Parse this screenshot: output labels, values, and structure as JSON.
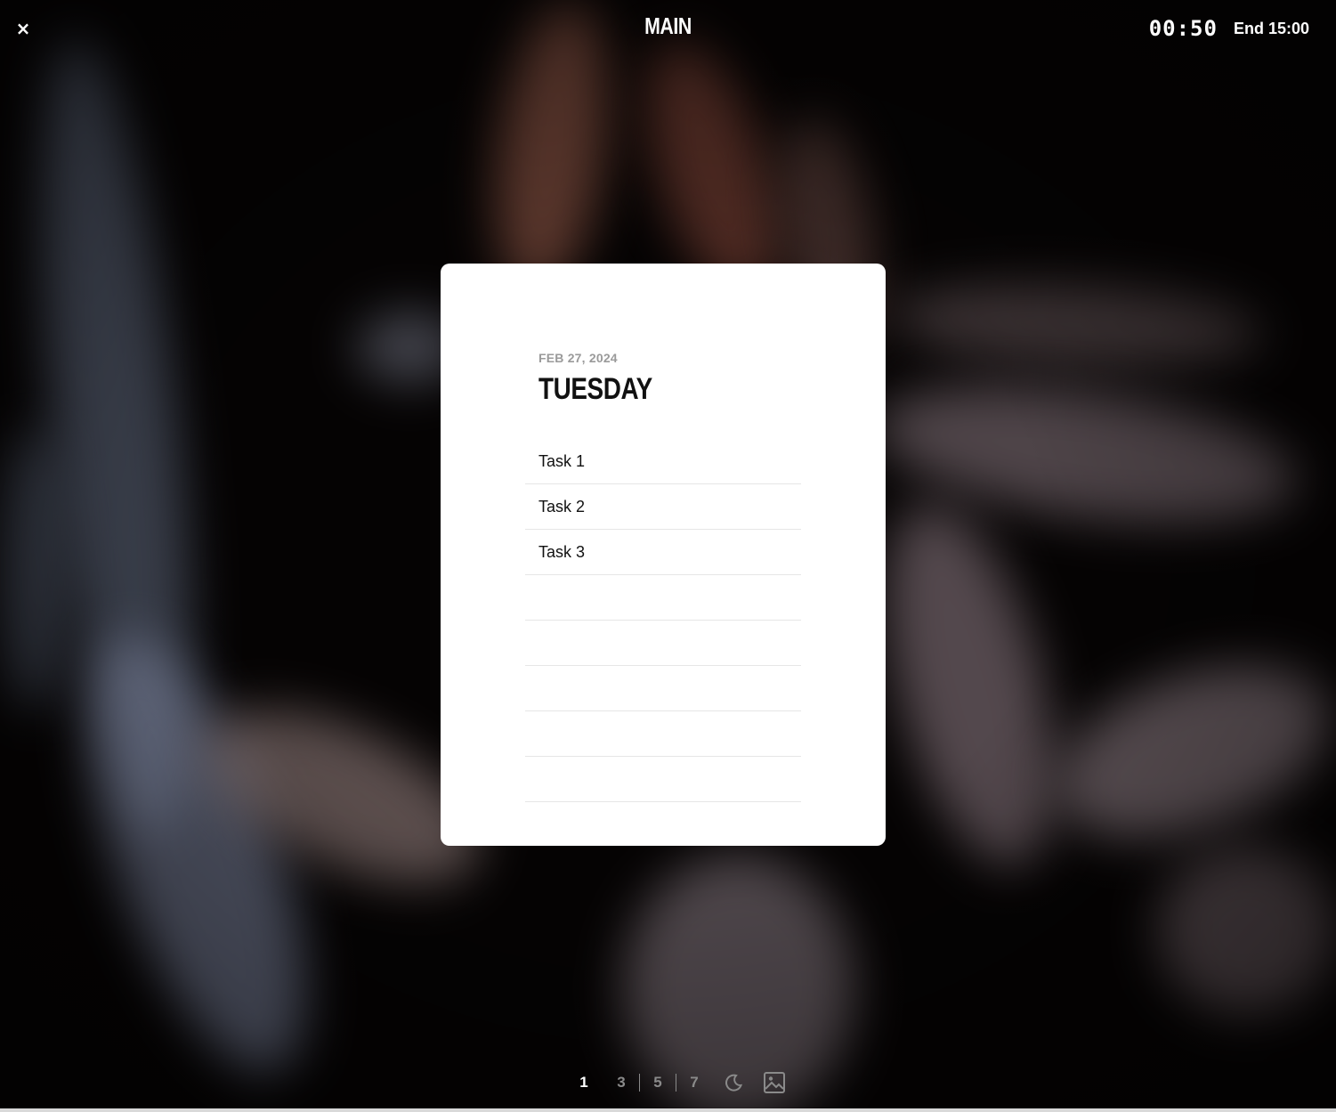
{
  "header": {
    "close_label": "×",
    "title": "MAIN",
    "timer": "00:50",
    "end_time": "End 15:00"
  },
  "card": {
    "date": "FEB 27, 2024",
    "day": "TUESDAY",
    "tasks": [
      "Task 1",
      "Task 2",
      "Task 3",
      "",
      "",
      "",
      "",
      ""
    ]
  },
  "footer": {
    "options": [
      "1",
      "3",
      "5",
      "7"
    ],
    "selected": "1",
    "icons": [
      "moon-icon",
      "image-icon"
    ]
  },
  "colors": {
    "card_bg": "#ffffff",
    "text_primary": "#111111",
    "text_muted": "#9a9a9a",
    "inactive_option": "#8a8a8a"
  }
}
